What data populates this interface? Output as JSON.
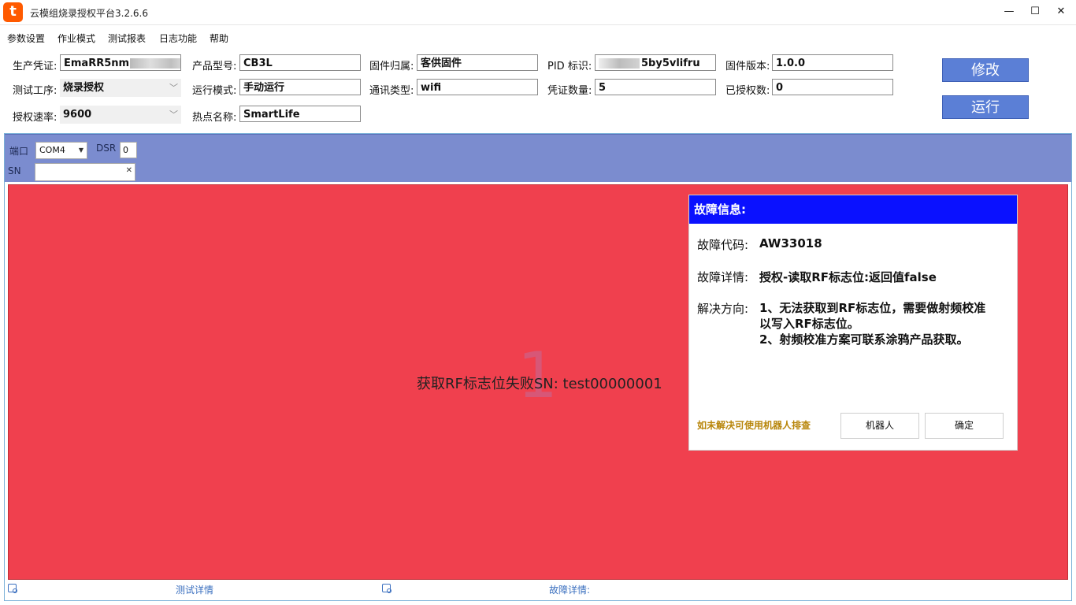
{
  "window": {
    "title": "云模组烧录授权平台3.2.6.6",
    "app_icon_glyph": "t",
    "minimize_glyph": "—",
    "maximize_glyph": "☐",
    "close_glyph": "✕",
    "accent_color": "#ff5a00"
  },
  "menu": [
    "参数设置",
    "作业模式",
    "测试报表",
    "日志功能",
    "帮助"
  ],
  "form": {
    "credential_label": "生产凭证:",
    "credential_value": "EmaRR5nm",
    "process_label": "测试工序:",
    "process_value": "烧录授权",
    "baud_label": "授权速率:",
    "baud_value": "9600",
    "product_model_label": "产品型号:",
    "product_model_value": "CB3L",
    "run_mode_label": "运行模式:",
    "run_mode_value": "手动运行",
    "hotspot_label": "热点名称:",
    "hotspot_value": "SmartLife",
    "firmware_owner_label": "固件归属:",
    "firmware_owner_value": "客供固件",
    "comm_type_label": "通讯类型:",
    "comm_type_value": "wifi",
    "pid_label": "PID 标识:",
    "pid_value": "5by5vlifru",
    "cred_count_label": "凭证数量:",
    "cred_count_value": "5",
    "fw_version_label": "固件版本:",
    "fw_version_value": "1.0.0",
    "authorized_label": "已授权数:",
    "authorized_value": "0"
  },
  "buttons": {
    "modify": "修改",
    "run": "运行",
    "modify_color": "#5b7fd6"
  },
  "port_panel": {
    "port_label": "端口",
    "port_value": "COM4",
    "dsr_label": "DSR",
    "dsr_value": "0",
    "sn_label": "SN",
    "sn_value": "",
    "panel_color": "#7b8ccf"
  },
  "status": {
    "big_number": "1",
    "message": "获取RF标志位失败SN: test00000001",
    "fail_color": "#f0404e"
  },
  "dialog": {
    "title": "故障信息:",
    "code_label": "故障代码:",
    "code_value": "AW33018",
    "detail_label": "故障详情:",
    "detail_value": "授权-读取RF标志位:返回值false",
    "solution_label": "解决方向:",
    "solution_line1": "1、无法获取到RF标志位，需要做射频校准",
    "solution_line2": "以写入RF标志位。",
    "solution_line3": "2、射频校准方案可联系涂鸦产品获取。",
    "hint": "如未解决可使用机器人排查",
    "robot_button": "机器人",
    "ok_button": "确定",
    "header_color": "#0a11ff"
  },
  "bottom": {
    "test_detail": "测试详情",
    "fault_detail": "故障详情:"
  }
}
